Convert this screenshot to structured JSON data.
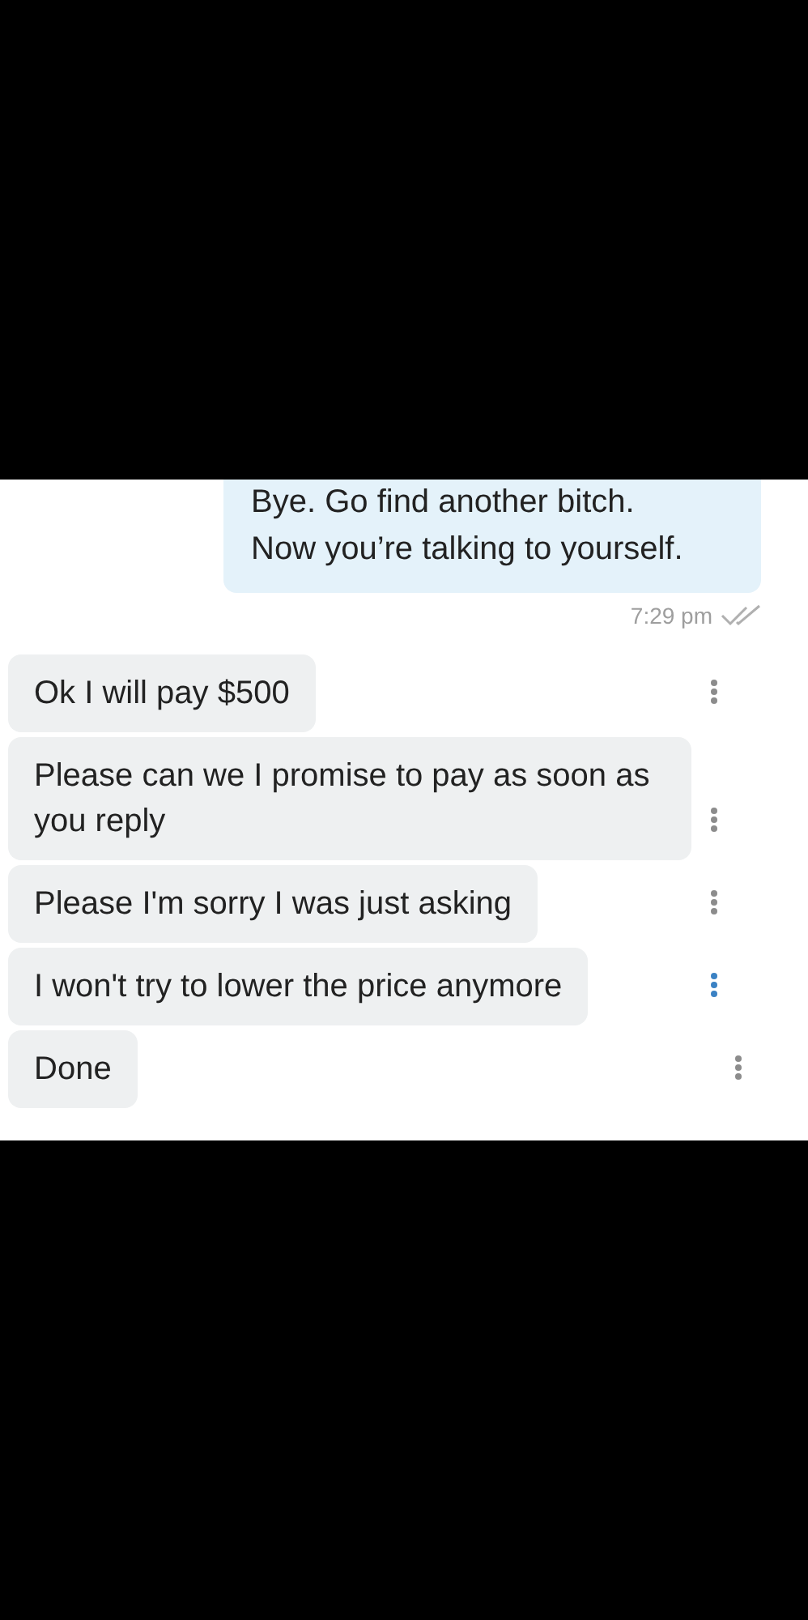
{
  "outgoing": {
    "lines": [
      "Bye. Go find another bitch.",
      "Now you’re talking to yourself."
    ],
    "time": "7:29 pm",
    "read": true
  },
  "incoming": [
    {
      "text": "Ok I will pay $500",
      "menu_highlighted": false
    },
    {
      "text": "Please can we I promise to pay as soon as you reply",
      "menu_highlighted": false
    },
    {
      "text": "Please I'm sorry I was just asking",
      "menu_highlighted": false
    },
    {
      "text": "I won't try to lower the price anymore",
      "menu_highlighted": true
    },
    {
      "text": "Done",
      "menu_highlighted": false
    }
  ]
}
